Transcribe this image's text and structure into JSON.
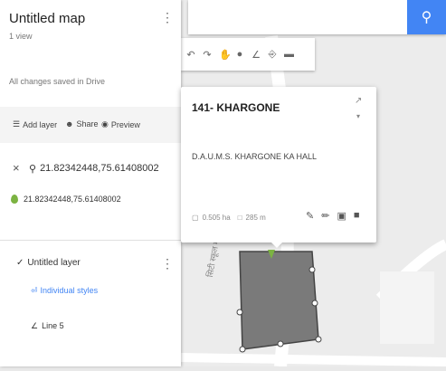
{
  "map": {
    "title": "Untitled map",
    "views": "1 view",
    "save_status": "All changes saved in Drive",
    "add_layer": "Add layer",
    "share": "Share",
    "preview": "Preview"
  },
  "search_result": {
    "query": "21.82342448,75.61408002",
    "pin_label": "21.82342448,75.61408002"
  },
  "layer": {
    "name": "Untitled layer",
    "style": "Individual styles",
    "item": "Line 5"
  },
  "card": {
    "title": "141- KHARGONE",
    "description": "D.A.U.M.S. KHARGONE KA HALL",
    "area": "0.505 ha",
    "perimeter": "285 m"
  },
  "map_labels": {
    "road": "सिटी स्कूल मार्ग"
  },
  "colors": {
    "accent": "#4285f4",
    "pin": "#7cb342",
    "polygon": "#7a7a7a"
  },
  "icons": [
    "search-icon",
    "undo-icon",
    "redo-icon",
    "hand-icon",
    "marker-icon",
    "line-icon",
    "route-icon",
    "ruler-icon",
    "paint-icon",
    "edit-icon",
    "camera-icon",
    "delete-icon"
  ]
}
